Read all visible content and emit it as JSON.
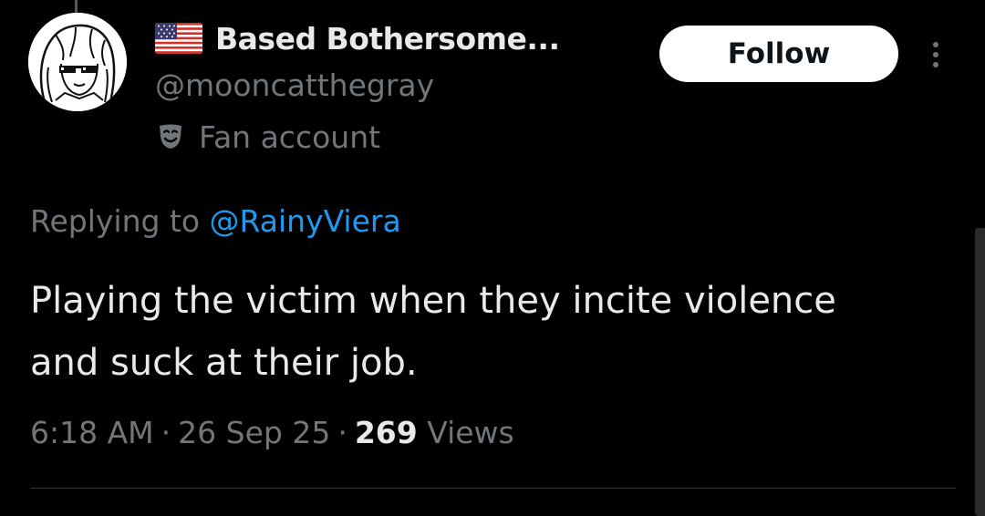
{
  "author": {
    "display_name": "Based Bothersome...",
    "handle": "@mooncatthegray",
    "flag_icon": "us-flag-icon",
    "label_icon": "theater-mask-icon",
    "label": "Fan account",
    "avatar_icon": "anime-avatar-with-pixel-sunglasses"
  },
  "actions": {
    "follow_label": "Follow",
    "more_icon": "more-vertical-icon"
  },
  "reply": {
    "prefix": "Replying to ",
    "mention": "@RainyViera"
  },
  "tweet": {
    "text": "Playing the victim when they incite violence and suck at their job."
  },
  "meta": {
    "time": "6:18 AM",
    "separator": "·",
    "date": "26 Sep 25",
    "views_count": "269",
    "views_label": "Views"
  },
  "colors": {
    "background": "#000000",
    "primary_text": "#e7e9ea",
    "secondary_text": "#71767b",
    "link": "#1d9bf0",
    "follow_button_bg": "#ffffff",
    "follow_button_text": "#0f1419",
    "divider": "#2f3336"
  }
}
